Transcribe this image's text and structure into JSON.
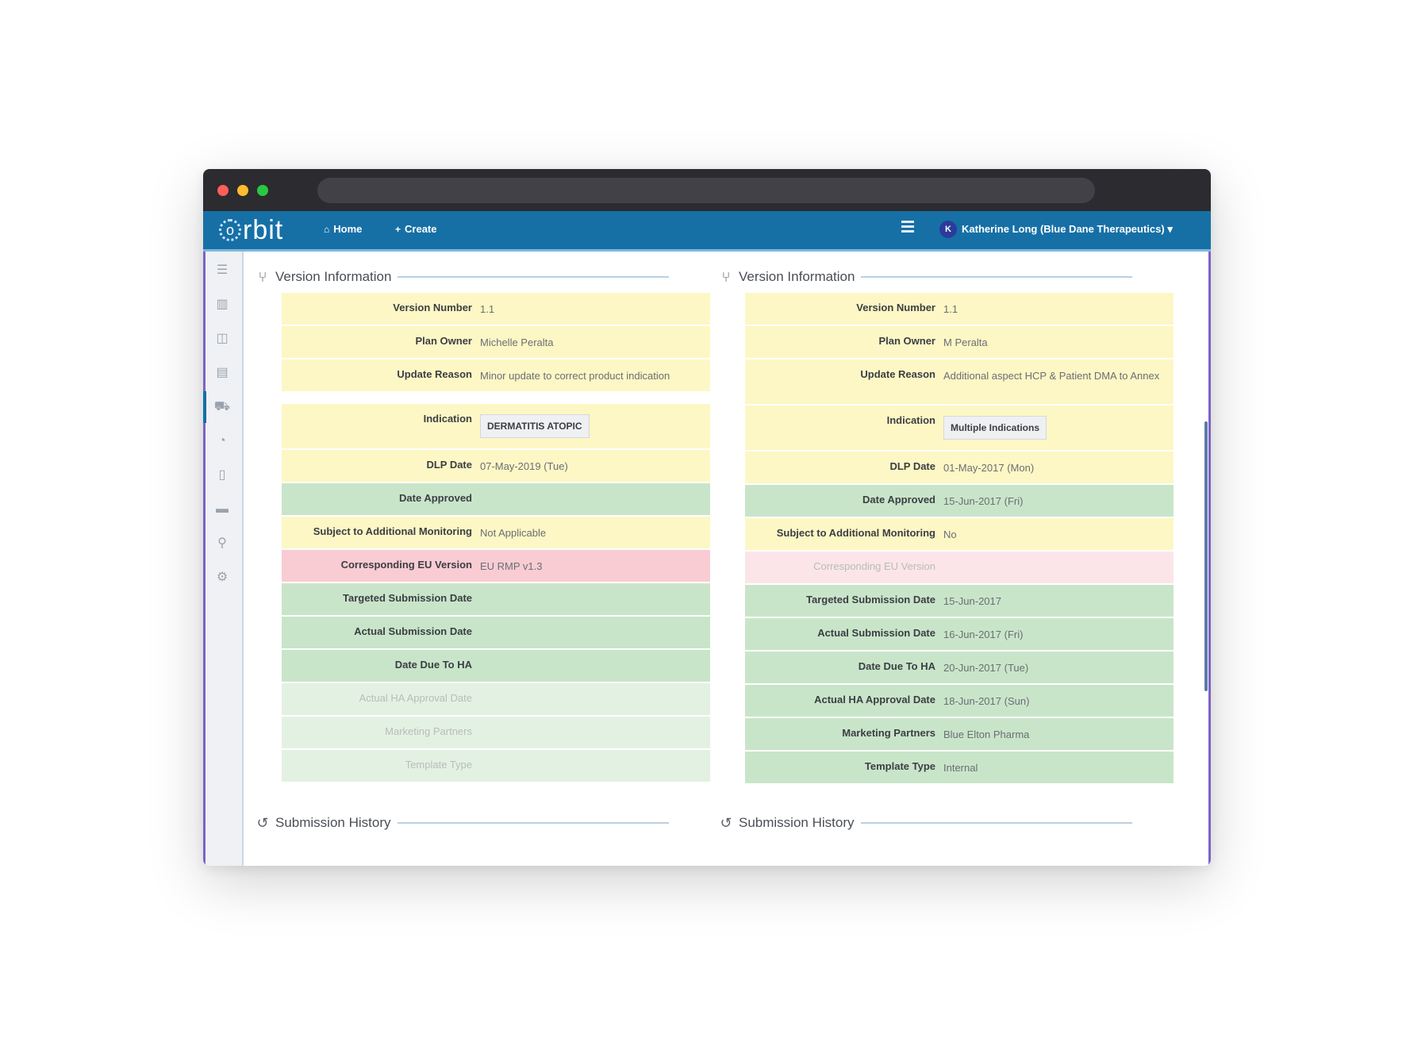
{
  "app": {
    "logo_mark": "o",
    "logo_text": "rbit",
    "nav": {
      "home_icon": "home-icon",
      "home": "Home",
      "create_icon": "plus-icon",
      "create": "Create"
    },
    "user": {
      "initial": "K",
      "label": "Katherine Long (Blue Dane Therapeutics) ▾"
    }
  },
  "sidebar": {
    "icons": [
      "☰",
      "▥",
      "◫",
      "▤",
      "⛟",
      "◔",
      "▯",
      "▬",
      "⚲",
      "⚙"
    ]
  },
  "left": {
    "section_title": "Version Information",
    "rows": [
      {
        "label": "Version Number",
        "value": "1.1"
      },
      {
        "label": "Plan Owner",
        "value": "Michelle Peralta"
      },
      {
        "label": "Update Reason",
        "value": "Minor update to correct product indication"
      },
      {
        "label": "Indication",
        "value": "DERMATITIS ATOPIC"
      },
      {
        "label": "DLP Date",
        "value": "07-May-2019 (Tue)"
      },
      {
        "label": "Date Approved",
        "value": ""
      },
      {
        "label": "Subject to Additional Monitoring",
        "value": "Not Applicable"
      },
      {
        "label": "Corresponding EU Version",
        "value": "EU RMP v1.3"
      },
      {
        "label": "Targeted Submission Date",
        "value": ""
      },
      {
        "label": "Actual Submission Date",
        "value": ""
      },
      {
        "label": "Date Due To HA",
        "value": ""
      },
      {
        "label": "Actual HA Approval Date",
        "value": ""
      },
      {
        "label": "Marketing Partners",
        "value": ""
      },
      {
        "label": "Template Type",
        "value": ""
      }
    ],
    "history_title": "Submission History"
  },
  "right": {
    "section_title": "Version Information",
    "rows": [
      {
        "label": "Version Number",
        "value": "1.1"
      },
      {
        "label": "Plan Owner",
        "value": "M Peralta"
      },
      {
        "label": "Update Reason",
        "value": "Additional aspect HCP & Patient DMA to Annex"
      },
      {
        "label": "Indication",
        "value": "Multiple Indications"
      },
      {
        "label": "DLP Date",
        "value": "01-May-2017 (Mon)"
      },
      {
        "label": "Date Approved",
        "value": "15-Jun-2017 (Fri)"
      },
      {
        "label": "Subject to Additional Monitoring",
        "value": "No"
      },
      {
        "label": "Corresponding EU Version",
        "value": ""
      },
      {
        "label": "Targeted Submission Date",
        "value": "15-Jun-2017"
      },
      {
        "label": "Actual Submission Date",
        "value": "16-Jun-2017 (Fri)"
      },
      {
        "label": "Date Due To HA",
        "value": "20-Jun-2017 (Tue)"
      },
      {
        "label": "Actual HA Approval Date",
        "value": "18-Jun-2017 (Sun)"
      },
      {
        "label": "Marketing Partners",
        "value": "Blue Elton Pharma"
      },
      {
        "label": "Template Type",
        "value": "Internal"
      }
    ],
    "history_title": "Submission History"
  },
  "colors": {
    "header": "#1670a6",
    "yellow_row": "#fdf7c5",
    "green_row": "#c9e5c9",
    "red_row": "#f9ccd3",
    "accent": "#7b63c7"
  }
}
